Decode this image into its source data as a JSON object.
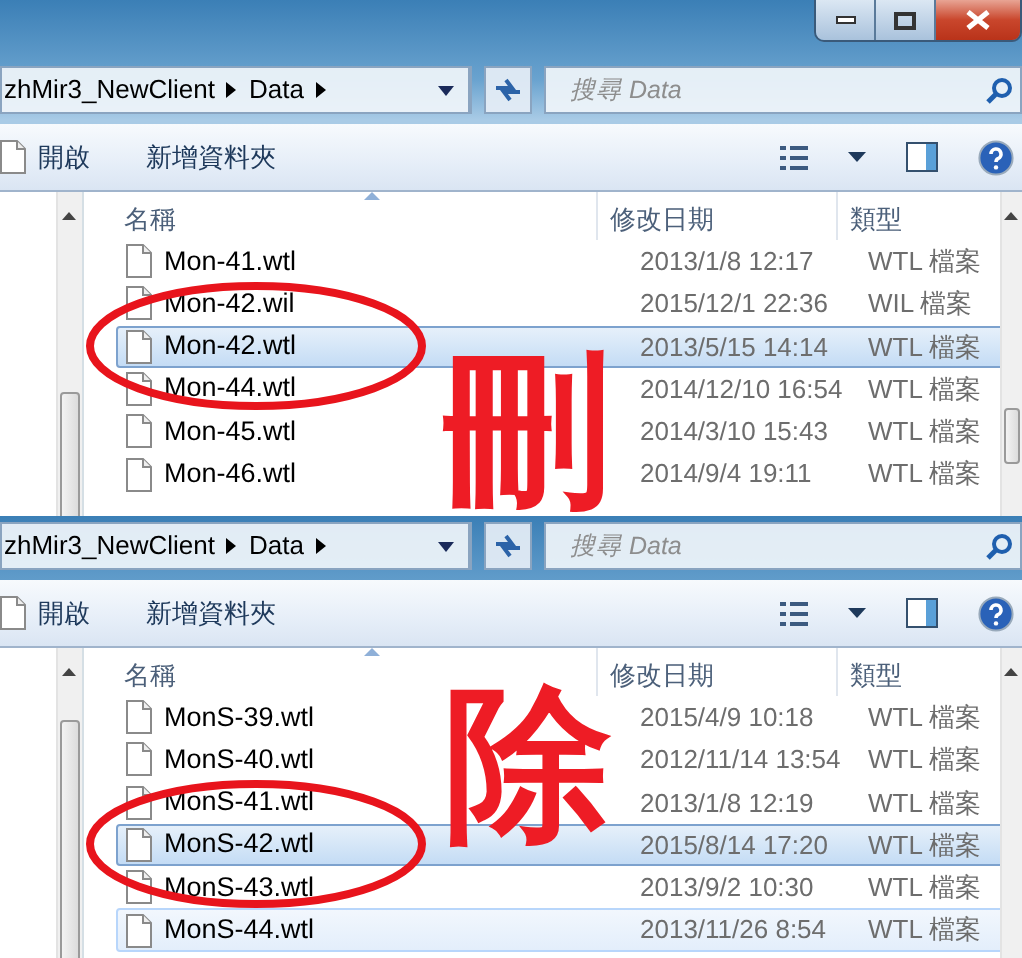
{
  "windows": [
    {
      "has_title_bar": true,
      "circled": true,
      "address": {
        "crumbs": [
          "zhMir3_NewClient",
          "Data"
        ]
      },
      "search": {
        "placeholder": "搜尋 Data"
      },
      "toolbar": {
        "open": "開啟",
        "new_folder": "新增資料夾"
      },
      "columns": [
        "名稱",
        "修改日期",
        "類型"
      ],
      "files": [
        {
          "name": "Mon-41.wtl",
          "modified": "2013/1/8 12:17",
          "type": "WTL 檔案",
          "selected": false,
          "hovered": false
        },
        {
          "name": "Mon-42.wil",
          "modified": "2015/12/1 22:36",
          "type": "WIL 檔案",
          "selected": false,
          "hovered": false
        },
        {
          "name": "Mon-42.wtl",
          "modified": "2013/5/15 14:14",
          "type": "WTL 檔案",
          "selected": true,
          "hovered": false
        },
        {
          "name": "Mon-44.wtl",
          "modified": "2014/12/10 16:54",
          "type": "WTL 檔案",
          "selected": false,
          "hovered": false
        },
        {
          "name": "Mon-45.wtl",
          "modified": "2014/3/10 15:43",
          "type": "WTL 檔案",
          "selected": false,
          "hovered": false
        },
        {
          "name": "Mon-46.wtl",
          "modified": "2014/9/4 19:11",
          "type": "WTL 檔案",
          "selected": false,
          "hovered": false
        }
      ]
    },
    {
      "has_title_bar": false,
      "circled": true,
      "address": {
        "crumbs": [
          "zhMir3_NewClient",
          "Data"
        ]
      },
      "search": {
        "placeholder": "搜尋 Data"
      },
      "toolbar": {
        "open": "開啟",
        "new_folder": "新增資料夾"
      },
      "columns": [
        "名稱",
        "修改日期",
        "類型"
      ],
      "files": [
        {
          "name": "MonS-39.wtl",
          "modified": "2015/4/9 10:18",
          "type": "WTL 檔案",
          "selected": false,
          "hovered": false
        },
        {
          "name": "MonS-40.wtl",
          "modified": "2012/11/14 13:54",
          "type": "WTL 檔案",
          "selected": false,
          "hovered": false
        },
        {
          "name": "MonS-41.wtl",
          "modified": "2013/1/8 12:19",
          "type": "WTL 檔案",
          "selected": false,
          "hovered": false
        },
        {
          "name": "MonS-42.wtl",
          "modified": "2015/8/14 17:20",
          "type": "WTL 檔案",
          "selected": true,
          "hovered": false
        },
        {
          "name": "MonS-43.wtl",
          "modified": "2013/9/2 10:30",
          "type": "WTL 檔案",
          "selected": false,
          "hovered": false
        },
        {
          "name": "MonS-44.wtl",
          "modified": "2013/11/26 8:54",
          "type": "WTL 檔案",
          "selected": false,
          "hovered": true
        }
      ]
    }
  ],
  "annotations": [
    {
      "text": "刪"
    },
    {
      "text": "除"
    }
  ]
}
